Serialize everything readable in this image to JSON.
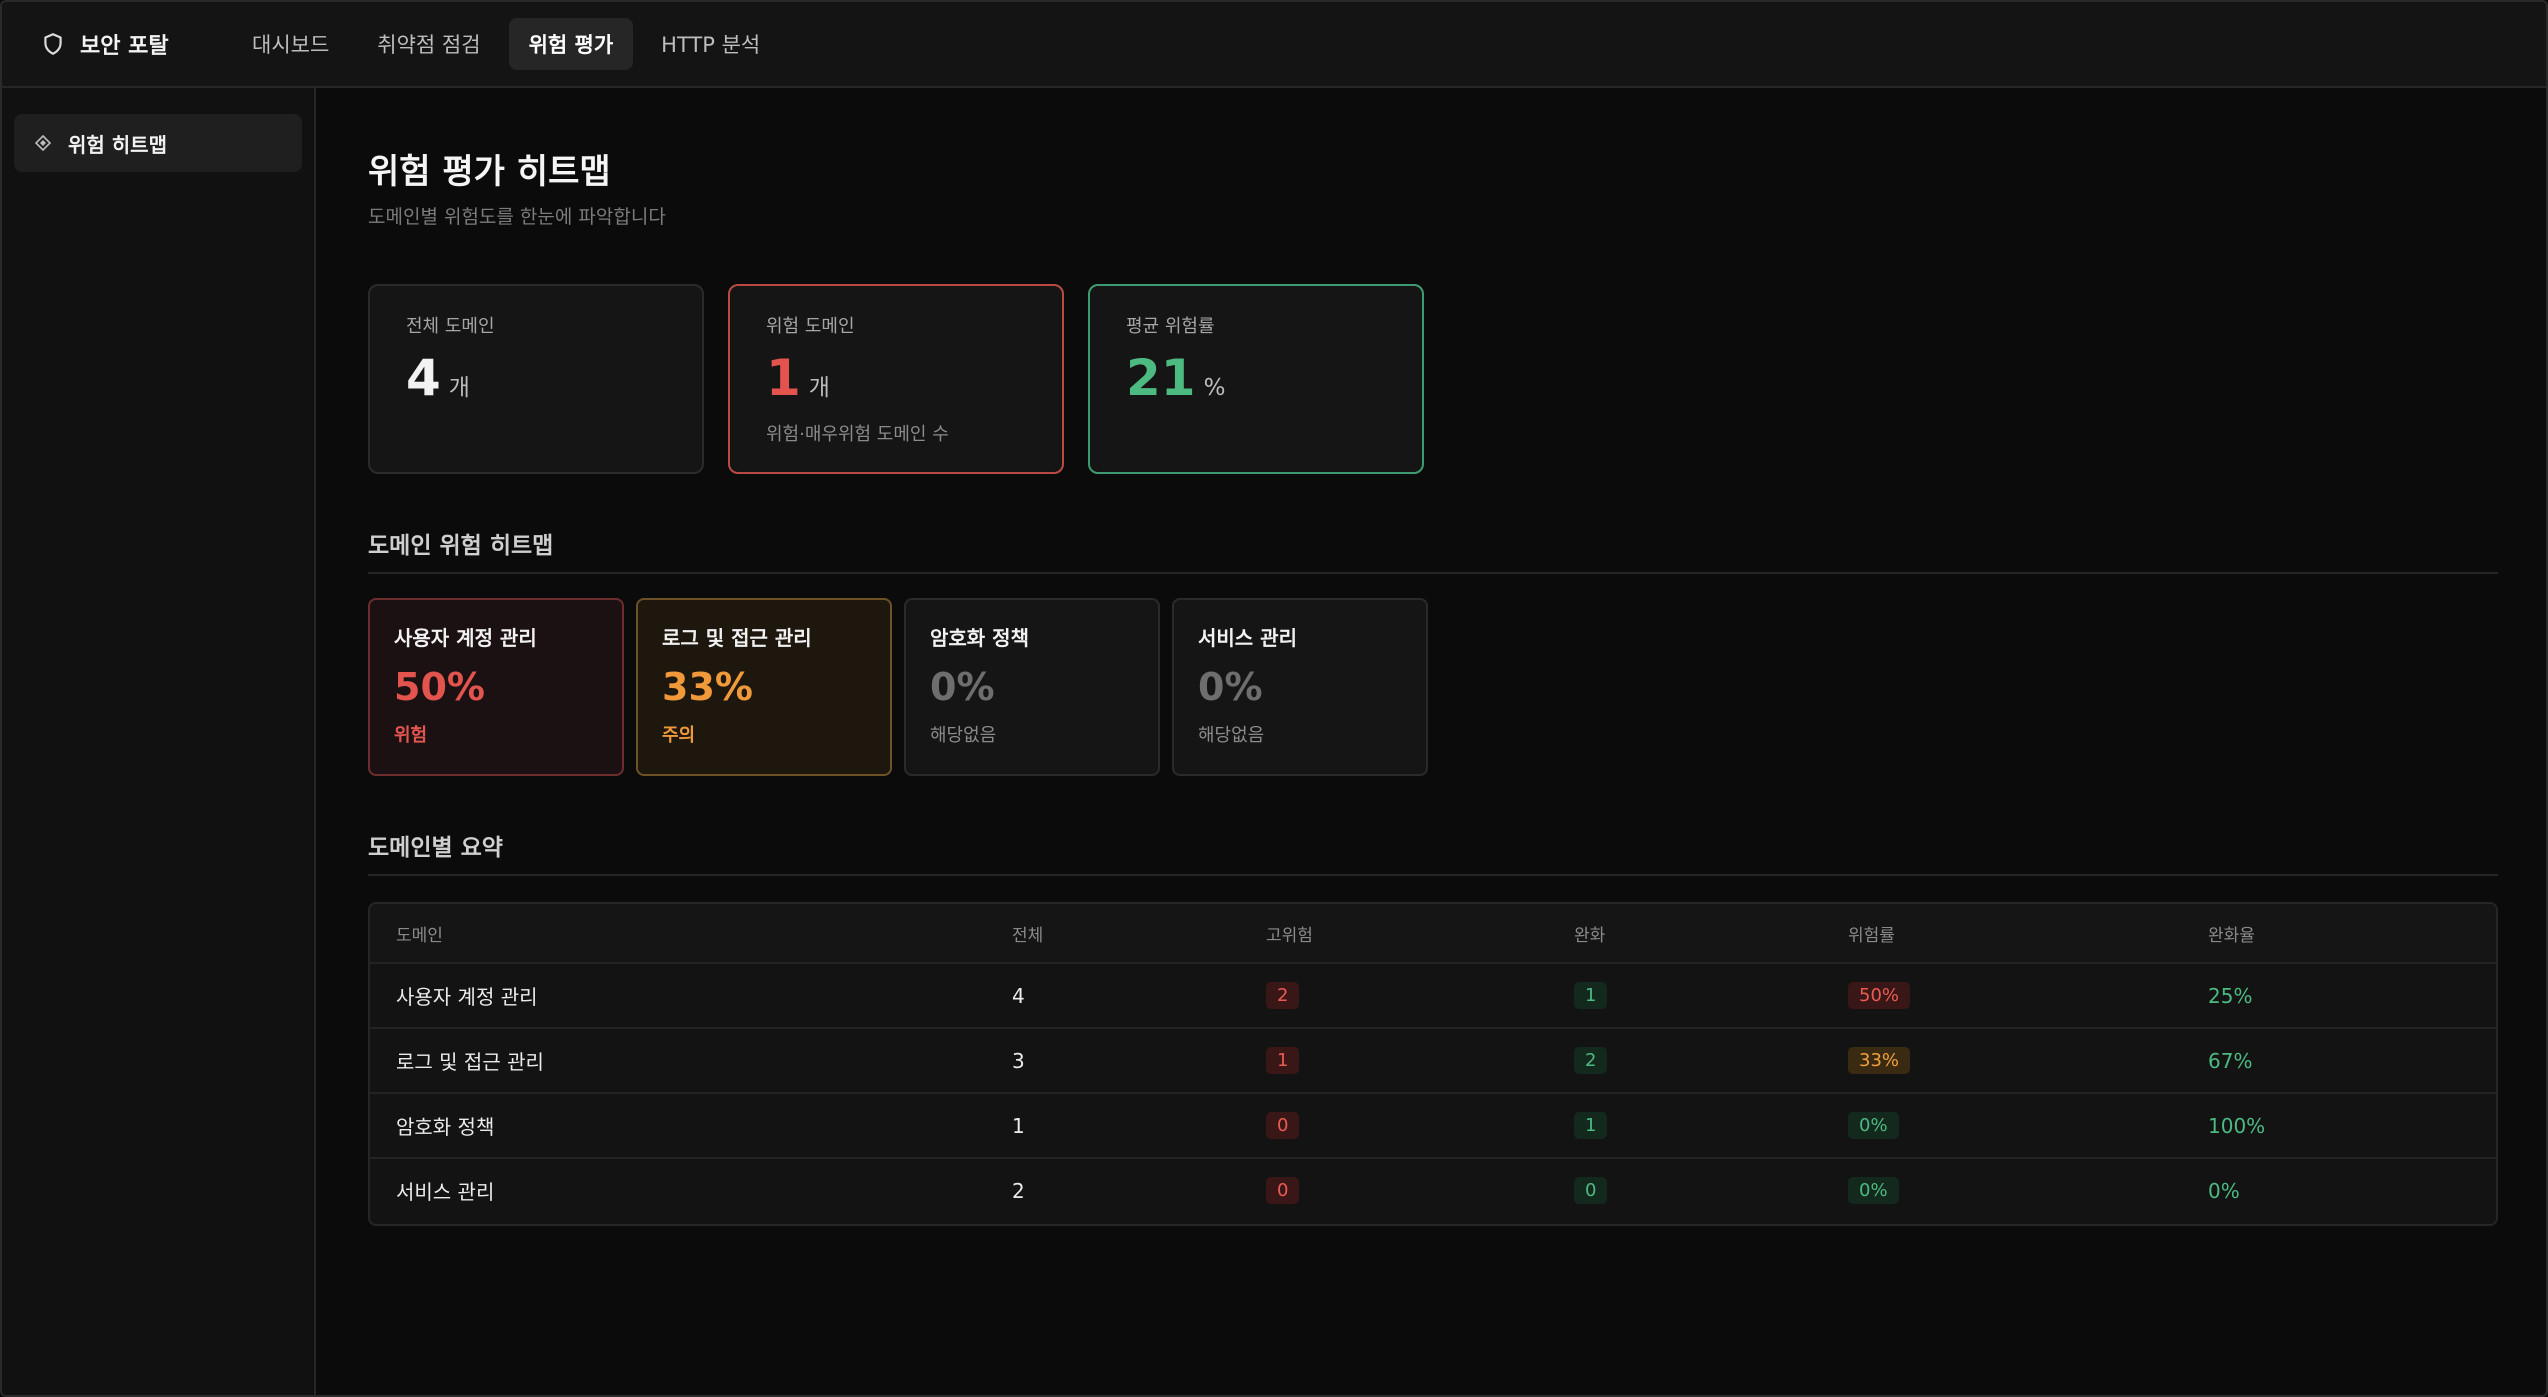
{
  "app": {
    "brand": "보안 포탈",
    "nav": [
      "대시보드",
      "취약점 점검",
      "위험 평가",
      "HTTP 분석"
    ],
    "active_nav": "위험 평가"
  },
  "sidebar": {
    "items": [
      {
        "label": "위험 히트맵",
        "icon": "diamond-icon"
      }
    ]
  },
  "page": {
    "title": "위험 평가 히트맵",
    "subtitle": "도메인별 위험도를 한눈에 파악합니다"
  },
  "stats": [
    {
      "label": "전체 도메인",
      "value": "4",
      "unit": "개",
      "note": ""
    },
    {
      "label": "위험 도메인",
      "value": "1",
      "unit": "개",
      "note": "위험·매우위험 도메인 수"
    },
    {
      "label": "평균 위험률",
      "value": "21",
      "unit": "%",
      "note": ""
    }
  ],
  "heatmap": {
    "title": "도메인 위험 히트맵",
    "cells": [
      {
        "name": "사용자 계정 관리",
        "pct": "50%",
        "level": "위험"
      },
      {
        "name": "로그 및 접근 관리",
        "pct": "33%",
        "level": "주의"
      },
      {
        "name": "암호화 정책",
        "pct": "0%",
        "level": "해당없음"
      },
      {
        "name": "서비스 관리",
        "pct": "0%",
        "level": "해당없음"
      }
    ]
  },
  "summary": {
    "title": "도메인별 요약",
    "columns": [
      "도메인",
      "전체",
      "고위험",
      "완화",
      "위험률",
      "완화율"
    ],
    "rows": [
      [
        "사용자 계정 관리",
        "4",
        "2",
        "1",
        "50%",
        "25%"
      ],
      [
        "로그 및 접근 관리",
        "3",
        "1",
        "2",
        "33%",
        "67%"
      ],
      [
        "암호화 정책",
        "1",
        "0",
        "1",
        "0%",
        "100%"
      ],
      [
        "서비스 관리",
        "2",
        "0",
        "0",
        "0%",
        "0%"
      ]
    ]
  },
  "colors": {
    "danger": "#e2544d",
    "warning": "#f0993a",
    "success": "#4dba82",
    "background": "#0b0b0b"
  }
}
